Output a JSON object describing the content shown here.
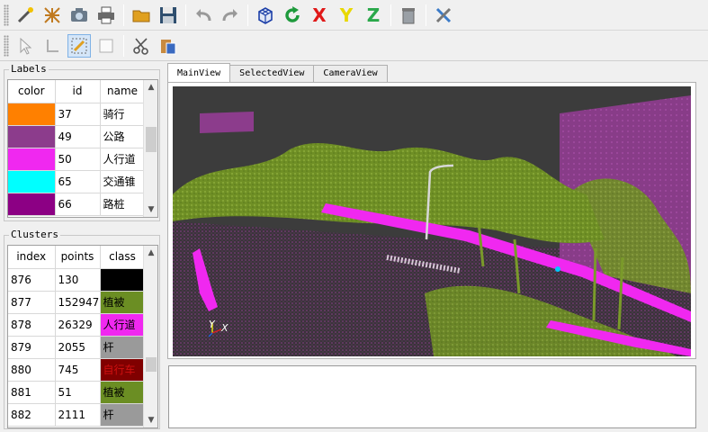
{
  "toolbar_main": {
    "axis_x": "X",
    "axis_y": "Y",
    "axis_z": "Z"
  },
  "labels_panel": {
    "title": "Labels",
    "columns": [
      "color",
      "id",
      "name"
    ],
    "rows": [
      {
        "color": "#ff8000",
        "id": "37",
        "name": "骑行"
      },
      {
        "color": "#8c3c8c",
        "id": "49",
        "name": "公路"
      },
      {
        "color": "#f028f0",
        "id": "50",
        "name": "人行道"
      },
      {
        "color": "#00ffff",
        "id": "65",
        "name": "交通锥"
      },
      {
        "color": "#8c0084",
        "id": "66",
        "name": "路桩"
      }
    ]
  },
  "clusters_panel": {
    "title": "Clusters",
    "columns": [
      "index",
      "points",
      "class"
    ],
    "rows": [
      {
        "index": "876",
        "points": "130",
        "class": "",
        "class_color": "#000000",
        "text_color": "#000000"
      },
      {
        "index": "877",
        "points": "152947",
        "class": "植被",
        "class_color": "#6b8e23",
        "text_color": "#000000"
      },
      {
        "index": "878",
        "points": "26329",
        "class": "人行道",
        "class_color": "#f028f0",
        "text_color": "#000000"
      },
      {
        "index": "879",
        "points": "2055",
        "class": "杆",
        "class_color": "#9a9a9a",
        "text_color": "#000000"
      },
      {
        "index": "880",
        "points": "745",
        "class": "自行车",
        "class_color": "#800000",
        "text_color": "#d01010"
      },
      {
        "index": "881",
        "points": "51",
        "class": "植被",
        "class_color": "#6b8e23",
        "text_color": "#000000"
      },
      {
        "index": "882",
        "points": "2111",
        "class": "杆",
        "class_color": "#9a9a9a",
        "text_color": "#000000"
      }
    ]
  },
  "view_tabs": [
    {
      "label": "MainView",
      "active": true
    },
    {
      "label": "SelectedView",
      "active": false
    },
    {
      "label": "CameraView",
      "active": false
    }
  ],
  "viewport": {
    "axis_y": "Y",
    "axis_x": "X"
  },
  "colors": {
    "vegetation": "#7a9a2a",
    "road": "#8c3c8c",
    "sidewalk": "#f028f0",
    "background": "#3c3c3c"
  }
}
